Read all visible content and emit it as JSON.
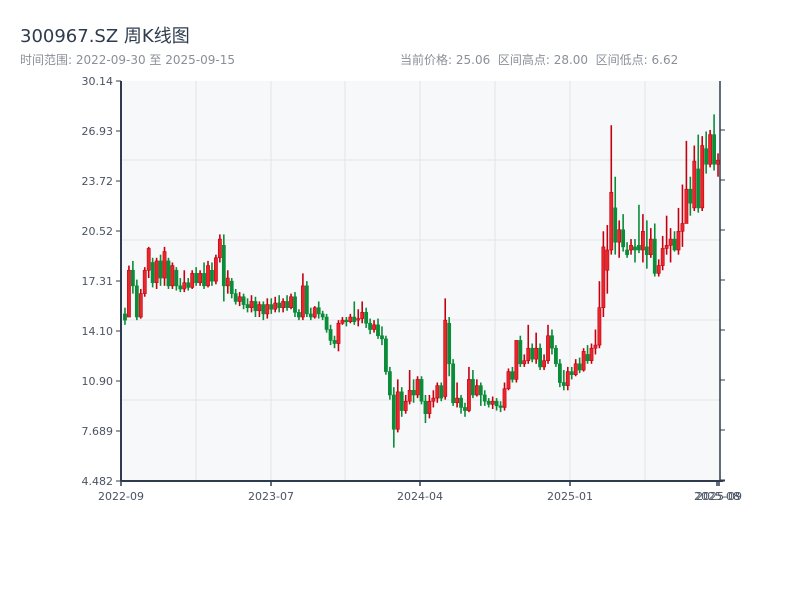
{
  "header": {
    "title": "300967.SZ 周K线图",
    "range_text": "时间范围: 2022-09-30 至 2025-09-15",
    "stats_text": "当前价格: 25.06  区间高点: 28.00  区间低点: 6.62"
  },
  "colors": {
    "up": "#e8262b",
    "up_border": "#c40010",
    "down": "#0b8c39",
    "axis": "#2e3b4e",
    "plot_bg": "#f7f8fa",
    "grid": "#e1e4ea"
  },
  "chart_data": {
    "type": "candlestick",
    "title": "300967.SZ 周K线图",
    "start_date": "2022-09-30",
    "end_date": "2025-09-15",
    "ylim": [
      4.482,
      30.14
    ],
    "y_ticks": [
      "30.14",
      "26.93",
      "23.72",
      "20.52",
      "17.31",
      "14.10",
      "10.90",
      "7.689",
      "4.482"
    ],
    "x_ticks": [
      "2022-09",
      "2023-07",
      "2024-04",
      "2025-01",
      "2025-08",
      "2025-09"
    ],
    "grid": true,
    "candle_format": [
      "open",
      "close",
      "low",
      "high"
    ],
    "candles": [
      [
        15.2,
        14.8,
        14.5,
        15.6
      ],
      [
        15.0,
        18.0,
        15.0,
        18.3
      ],
      [
        18.0,
        17.0,
        16.5,
        18.6
      ],
      [
        17.0,
        15.0,
        14.8,
        17.4
      ],
      [
        15.0,
        16.5,
        14.9,
        16.8
      ],
      [
        16.5,
        18.0,
        16.3,
        18.2
      ],
      [
        18.0,
        19.4,
        17.5,
        19.5
      ],
      [
        18.5,
        17.2,
        16.9,
        18.8
      ],
      [
        17.2,
        18.6,
        16.8,
        18.8
      ],
      [
        18.6,
        17.5,
        17.0,
        19.0
      ],
      [
        17.5,
        19.2,
        17.0,
        19.5
      ],
      [
        18.6,
        17.0,
        16.8,
        18.8
      ],
      [
        17.0,
        18.3,
        16.8,
        18.5
      ],
      [
        18.0,
        17.0,
        16.7,
        18.2
      ],
      [
        17.0,
        16.8,
        16.6,
        17.5
      ],
      [
        16.8,
        17.2,
        16.6,
        18.0
      ],
      [
        17.2,
        16.9,
        16.7,
        17.5
      ],
      [
        16.9,
        17.8,
        16.8,
        18.0
      ],
      [
        17.8,
        17.2,
        17.0,
        18.2
      ],
      [
        17.2,
        17.8,
        17.0,
        18.0
      ],
      [
        17.8,
        17.0,
        16.8,
        18.5
      ],
      [
        17.0,
        18.3,
        16.9,
        18.6
      ],
      [
        18.0,
        17.3,
        17.0,
        18.5
      ],
      [
        17.3,
        18.8,
        17.1,
        19.0
      ],
      [
        18.8,
        20.0,
        18.5,
        20.3
      ],
      [
        19.6,
        17.0,
        16.0,
        20.3
      ],
      [
        17.0,
        17.5,
        16.5,
        18.0
      ],
      [
        17.3,
        16.5,
        16.2,
        17.5
      ],
      [
        16.5,
        16.0,
        15.8,
        16.8
      ],
      [
        16.0,
        16.3,
        15.7,
        16.6
      ],
      [
        16.3,
        15.8,
        15.5,
        16.5
      ],
      [
        15.8,
        15.6,
        15.3,
        16.2
      ],
      [
        15.6,
        16.0,
        15.3,
        16.4
      ],
      [
        16.0,
        15.4,
        15.0,
        16.3
      ],
      [
        15.4,
        15.8,
        15.0,
        16.0
      ],
      [
        15.8,
        15.2,
        14.8,
        16.0
      ],
      [
        15.2,
        15.8,
        14.9,
        16.2
      ],
      [
        15.8,
        15.5,
        15.2,
        16.2
      ],
      [
        15.5,
        15.9,
        15.3,
        16.3
      ],
      [
        15.9,
        15.6,
        15.3,
        16.4
      ],
      [
        15.6,
        16.0,
        15.3,
        16.2
      ],
      [
        16.0,
        15.6,
        15.4,
        16.4
      ],
      [
        15.6,
        16.3,
        15.5,
        16.5
      ],
      [
        16.3,
        15.3,
        15.0,
        16.6
      ],
      [
        15.3,
        15.0,
        14.8,
        15.5
      ],
      [
        15.0,
        17.0,
        14.8,
        17.8
      ],
      [
        17.0,
        15.2,
        15.0,
        17.3
      ],
      [
        15.2,
        15.0,
        14.8,
        15.6
      ],
      [
        15.0,
        15.6,
        14.9,
        15.7
      ],
      [
        15.6,
        15.2,
        14.9,
        16.0
      ],
      [
        15.2,
        15.0,
        14.8,
        15.4
      ],
      [
        15.0,
        14.2,
        14.0,
        15.2
      ],
      [
        14.2,
        13.5,
        13.2,
        14.5
      ],
      [
        13.5,
        13.3,
        13.0,
        13.8
      ],
      [
        13.3,
        14.6,
        12.8,
        14.8
      ],
      [
        14.6,
        14.8,
        14.5,
        15.0
      ],
      [
        14.8,
        14.7,
        14.4,
        15.0
      ],
      [
        14.7,
        15.0,
        14.6,
        15.2
      ],
      [
        15.0,
        14.7,
        14.5,
        16.0
      ],
      [
        14.8,
        14.9,
        14.4,
        15.5
      ],
      [
        14.9,
        15.3,
        14.6,
        16.0
      ],
      [
        15.3,
        14.6,
        14.3,
        15.6
      ],
      [
        14.6,
        14.2,
        13.9,
        14.9
      ],
      [
        14.2,
        14.5,
        14.0,
        14.8
      ],
      [
        14.5,
        13.8,
        13.6,
        14.9
      ],
      [
        13.8,
        13.6,
        13.2,
        14.4
      ],
      [
        13.6,
        11.5,
        11.3,
        13.8
      ],
      [
        11.5,
        10.0,
        9.7,
        11.8
      ],
      [
        10.0,
        7.8,
        6.62,
        10.5
      ],
      [
        7.8,
        10.2,
        7.6,
        11.0
      ],
      [
        10.2,
        9.0,
        8.6,
        10.5
      ],
      [
        9.0,
        9.6,
        8.8,
        10.0
      ],
      [
        9.6,
        10.3,
        9.4,
        11.6
      ],
      [
        10.3,
        10.0,
        9.5,
        11.0
      ],
      [
        10.0,
        11.0,
        9.8,
        11.2
      ],
      [
        11.0,
        9.6,
        9.4,
        11.2
      ],
      [
        9.6,
        8.8,
        8.2,
        10.0
      ],
      [
        8.8,
        9.6,
        8.5,
        10.0
      ],
      [
        9.6,
        9.8,
        9.2,
        10.3
      ],
      [
        9.8,
        10.6,
        9.5,
        10.8
      ],
      [
        10.6,
        9.8,
        9.6,
        10.8
      ],
      [
        9.9,
        14.8,
        9.7,
        16.2
      ],
      [
        14.6,
        12.0,
        11.2,
        15.0
      ],
      [
        12.0,
        9.5,
        9.3,
        12.3
      ],
      [
        9.5,
        9.8,
        9.2,
        10.8
      ],
      [
        9.8,
        9.2,
        8.8,
        10.0
      ],
      [
        9.2,
        9.0,
        8.6,
        9.5
      ],
      [
        9.0,
        11.0,
        8.9,
        11.8
      ],
      [
        11.0,
        10.0,
        9.8,
        11.6
      ],
      [
        10.0,
        10.6,
        9.9,
        11.0
      ],
      [
        10.6,
        10.0,
        9.3,
        10.8
      ],
      [
        10.0,
        9.6,
        9.3,
        10.3
      ],
      [
        9.6,
        9.4,
        9.2,
        9.8
      ],
      [
        9.4,
        9.6,
        9.1,
        9.9
      ],
      [
        9.6,
        9.3,
        9.0,
        9.8
      ],
      [
        9.3,
        9.2,
        8.9,
        9.6
      ],
      [
        9.2,
        10.4,
        9.0,
        10.8
      ],
      [
        10.4,
        11.5,
        10.3,
        11.7
      ],
      [
        11.5,
        11.0,
        10.8,
        11.8
      ],
      [
        11.0,
        13.5,
        10.8,
        13.5
      ],
      [
        13.5,
        12.0,
        11.8,
        13.8
      ],
      [
        12.0,
        12.2,
        11.8,
        12.6
      ],
      [
        12.2,
        13.0,
        12.0,
        14.5
      ],
      [
        13.0,
        12.3,
        12.1,
        13.3
      ],
      [
        12.3,
        13.0,
        12.0,
        14.0
      ],
      [
        13.0,
        11.8,
        11.6,
        13.3
      ],
      [
        11.8,
        12.2,
        11.6,
        12.6
      ],
      [
        12.2,
        13.8,
        12.0,
        14.5
      ],
      [
        13.8,
        13.0,
        12.6,
        14.2
      ],
      [
        13.0,
        12.0,
        11.8,
        13.2
      ],
      [
        12.0,
        10.8,
        10.5,
        12.3
      ],
      [
        10.8,
        10.6,
        10.3,
        11.6
      ],
      [
        10.6,
        11.5,
        10.3,
        11.8
      ],
      [
        11.5,
        11.3,
        11.0,
        11.8
      ],
      [
        11.3,
        12.0,
        11.2,
        12.3
      ],
      [
        12.0,
        11.6,
        11.4,
        12.4
      ],
      [
        11.6,
        12.8,
        11.5,
        13.0
      ],
      [
        12.6,
        12.2,
        12.0,
        13.2
      ],
      [
        12.2,
        13.0,
        12.0,
        13.3
      ],
      [
        13.0,
        13.2,
        12.6,
        14.2
      ],
      [
        13.2,
        15.6,
        13.0,
        17.3
      ],
      [
        15.6,
        19.5,
        15.0,
        20.5
      ],
      [
        18.0,
        19.3,
        16.5,
        20.9
      ],
      [
        19.3,
        23.0,
        19.0,
        27.3
      ],
      [
        22.0,
        19.8,
        19.0,
        24.0
      ],
      [
        19.8,
        20.6,
        18.8,
        21.2
      ],
      [
        20.6,
        19.5,
        19.2,
        21.6
      ],
      [
        19.3,
        19.0,
        18.8,
        19.8
      ],
      [
        19.3,
        19.6,
        19.0,
        20.0
      ],
      [
        19.5,
        19.3,
        18.5,
        20.0
      ],
      [
        19.6,
        19.3,
        19.1,
        22.2
      ],
      [
        19.3,
        20.5,
        18.5,
        21.6
      ],
      [
        19.5,
        19.0,
        18.1,
        21.2
      ],
      [
        19.0,
        20.0,
        18.8,
        20.7
      ],
      [
        20.0,
        17.8,
        17.6,
        21.0
      ],
      [
        17.8,
        18.3,
        17.6,
        18.7
      ],
      [
        18.3,
        19.4,
        18.0,
        20.2
      ],
      [
        19.4,
        19.6,
        19.0,
        21.5
      ],
      [
        19.6,
        20.0,
        18.5,
        20.7
      ],
      [
        20.0,
        19.3,
        19.2,
        20.5
      ],
      [
        19.3,
        20.5,
        19.0,
        22.0
      ],
      [
        20.5,
        21.0,
        19.5,
        23.5
      ],
      [
        21.0,
        23.2,
        21.0,
        26.3
      ],
      [
        23.2,
        22.3,
        21.5,
        24.0
      ],
      [
        22.0,
        25.0,
        21.8,
        26.0
      ],
      [
        24.5,
        22.0,
        21.7,
        26.7
      ],
      [
        22.0,
        26.0,
        21.8,
        26.6
      ],
      [
        25.8,
        24.8,
        24.2,
        26.9
      ],
      [
        24.8,
        26.7,
        24.6,
        27.0
      ],
      [
        26.7,
        24.8,
        24.4,
        28.0
      ],
      [
        24.8,
        25.06,
        24.0,
        25.5
      ]
    ]
  }
}
